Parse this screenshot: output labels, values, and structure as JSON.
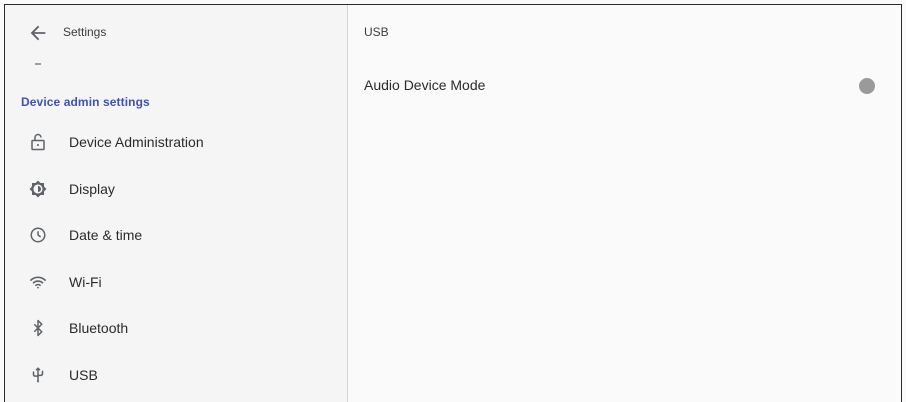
{
  "left_pane": {
    "title": "Settings",
    "back_icon": "arrow-left-icon",
    "section_title": "Device admin settings",
    "items": [
      {
        "label": "Device Administration",
        "icon": "unlock-icon"
      },
      {
        "label": "Display",
        "icon": "brightness-icon"
      },
      {
        "label": "Date & time",
        "icon": "clock-icon"
      },
      {
        "label": "Wi-Fi",
        "icon": "wifi-icon"
      },
      {
        "label": "Bluetooth",
        "icon": "bluetooth-icon"
      },
      {
        "label": "USB",
        "icon": "usb-icon"
      }
    ]
  },
  "right_pane": {
    "title": "USB",
    "preferences": [
      {
        "label": "Audio Device Mode",
        "toggle_state": "off"
      }
    ]
  },
  "colors": {
    "accent": "#3f51b5",
    "toggle_off": "#9a9a9a",
    "icon": "#5f6368",
    "background": "#fafafa"
  }
}
